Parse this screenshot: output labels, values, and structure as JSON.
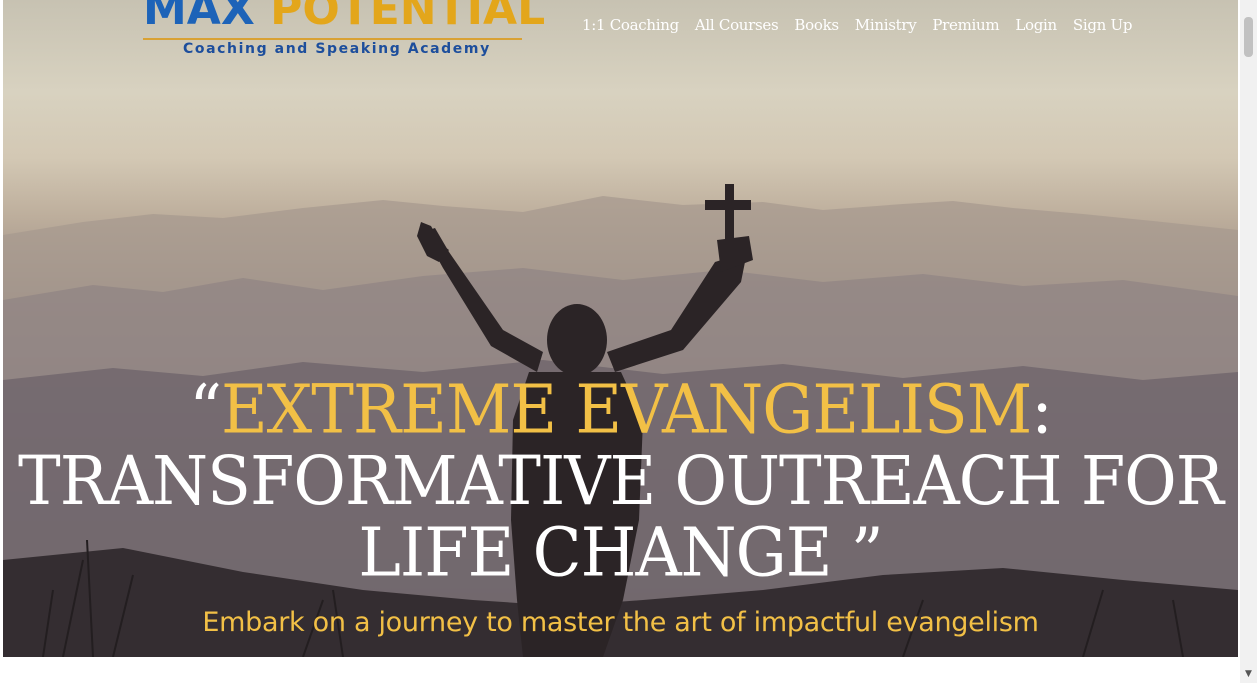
{
  "logo": {
    "title_part1": "MAX",
    "title_part2": " POTENTIAL",
    "subtitle": "Coaching and Speaking Academy"
  },
  "nav": {
    "items": [
      {
        "label": "1:1 Coaching"
      },
      {
        "label": "All Courses"
      },
      {
        "label": "Books"
      },
      {
        "label": "Ministry"
      },
      {
        "label": "Premium"
      },
      {
        "label": "Login"
      },
      {
        "label": "Sign Up"
      }
    ]
  },
  "hero": {
    "quote_open": "“",
    "headline_gold": "EXTREME EVANGELISM",
    "headline_colon": ":",
    "headline_line2": "TRANSFORMATIVE OUTREACH FOR",
    "headline_line3": "LIFE CHANGE ”",
    "tagline": "Embark on a journey to master the art of impactful evangelism"
  },
  "colors": {
    "accent_gold": "#f2c046",
    "logo_blue": "#1d63b8",
    "logo_gold": "#e3a61b",
    "text_white": "#ffffff"
  },
  "icons": {
    "scroll_down": "chevron-down-icon"
  }
}
